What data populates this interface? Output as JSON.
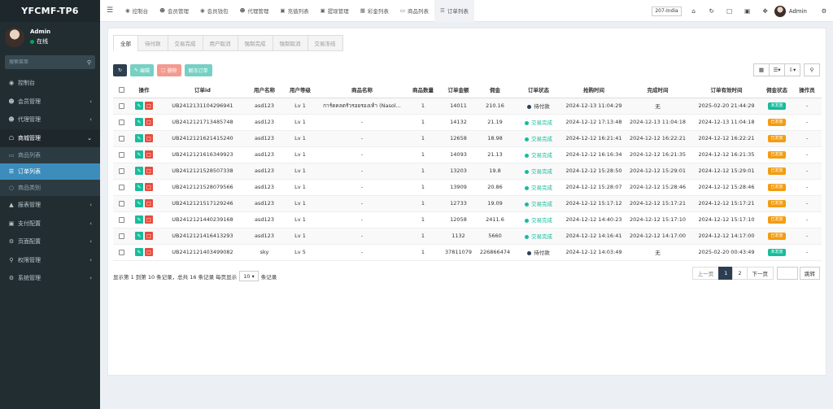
{
  "app": {
    "title": "YFCMF-TP6"
  },
  "sidebar": {
    "user_name": "Admin",
    "user_status": "在线",
    "search_placeholder": "搜索菜单",
    "menu": [
      {
        "label": "控制台",
        "icon": "dashboard-icon"
      },
      {
        "label": "会员管理",
        "icon": "user-icon"
      },
      {
        "label": "代理管理",
        "icon": "users-icon"
      },
      {
        "label": "商城管理",
        "icon": "shop-icon"
      }
    ],
    "submenu": [
      {
        "label": "商品列表",
        "icon": "monitor-icon"
      },
      {
        "label": "订单列表",
        "icon": "list-icon"
      },
      {
        "label": "商品类别",
        "icon": "circle-icon"
      }
    ],
    "menu2": [
      {
        "label": "报表管理",
        "icon": "chart-icon"
      },
      {
        "label": "支付配置",
        "icon": "card-icon"
      },
      {
        "label": "页面配置",
        "icon": "gear-icon"
      },
      {
        "label": "权限管理",
        "icon": "key-icon"
      },
      {
        "label": "系统管理",
        "icon": "cogs-icon"
      }
    ]
  },
  "topbar": {
    "tabs": [
      {
        "label": "控制台"
      },
      {
        "label": "会员管理"
      },
      {
        "label": "会员钱包"
      },
      {
        "label": "代理管理"
      },
      {
        "label": "充值列表"
      },
      {
        "label": "提现管理"
      },
      {
        "label": "彩金列表"
      },
      {
        "label": "商品列表"
      },
      {
        "label": "订单列表"
      }
    ],
    "language": "207-India",
    "admin_name": "Admin"
  },
  "filters": {
    "tabs": [
      "全部",
      "待付款",
      "交易完成",
      "用户取消",
      "强制完成",
      "强制取消",
      "交易冻结"
    ]
  },
  "toolbar": {
    "edit_label": "编辑",
    "delete_label": "删除",
    "unfreeze_label": "解冻订单"
  },
  "table": {
    "headers": [
      "",
      "操作",
      "订单id",
      "用户名称",
      "用户等级",
      "商品名称",
      "商品数量",
      "订单金额",
      "佣金",
      "订单状态",
      "抢购时间",
      "完成时间",
      "订单有效时间",
      "佣金状态",
      "操作员"
    ],
    "rows": [
      {
        "id": "UB2412131104296941",
        "user": "asd123",
        "level": "Lv 1",
        "product": "การ์ดคลตรัวรอยรองเท้า (Nasol...",
        "qty": "1",
        "amount": "14011",
        "commission": "210.16",
        "status": "待付款",
        "status_type": "pending",
        "grab_time": "2024-12-13 11:04:29",
        "finish_time": "无",
        "valid_time": "2025-02-20 21:44:29",
        "comm_status": "未发放",
        "comm_type": "green",
        "operator": "-"
      },
      {
        "id": "UB2412121713485748",
        "user": "asd123",
        "level": "Lv 1",
        "product": "-",
        "qty": "1",
        "amount": "14132",
        "commission": "21.19",
        "status": "交易完成",
        "status_type": "done",
        "grab_time": "2024-12-12 17:13:48",
        "finish_time": "2024-12-13 11:04:18",
        "valid_time": "2024-12-13 11:04:18",
        "comm_status": "已发放",
        "comm_type": "orange",
        "operator": "-"
      },
      {
        "id": "UB2412121621415240",
        "user": "asd123",
        "level": "Lv 1",
        "product": "-",
        "qty": "1",
        "amount": "12658",
        "commission": "18.98",
        "status": "交易完成",
        "status_type": "done",
        "grab_time": "2024-12-12 16:21:41",
        "finish_time": "2024-12-12 16:22:21",
        "valid_time": "2024-12-12 16:22:21",
        "comm_status": "已发放",
        "comm_type": "orange",
        "operator": "-"
      },
      {
        "id": "UB2412121616349923",
        "user": "asd123",
        "level": "Lv 1",
        "product": "-",
        "qty": "1",
        "amount": "14093",
        "commission": "21.13",
        "status": "交易完成",
        "status_type": "done",
        "grab_time": "2024-12-12 16:16:34",
        "finish_time": "2024-12-12 16:21:35",
        "valid_time": "2024-12-12 16:21:35",
        "comm_status": "已发放",
        "comm_type": "orange",
        "operator": "-"
      },
      {
        "id": "UB2412121528507338",
        "user": "asd123",
        "level": "Lv 1",
        "product": "-",
        "qty": "1",
        "amount": "13203",
        "commission": "19.8",
        "status": "交易完成",
        "status_type": "done",
        "grab_time": "2024-12-12 15:28:50",
        "finish_time": "2024-12-12 15:29:01",
        "valid_time": "2024-12-12 15:29:01",
        "comm_status": "已发放",
        "comm_type": "orange",
        "operator": "-"
      },
      {
        "id": "UB2412121528079566",
        "user": "asd123",
        "level": "Lv 1",
        "product": "-",
        "qty": "1",
        "amount": "13909",
        "commission": "20.86",
        "status": "交易完成",
        "status_type": "done",
        "grab_time": "2024-12-12 15:28:07",
        "finish_time": "2024-12-12 15:28:46",
        "valid_time": "2024-12-12 15:28:46",
        "comm_status": "已发放",
        "comm_type": "orange",
        "operator": "-"
      },
      {
        "id": "UB2412121517129246",
        "user": "asd123",
        "level": "Lv 1",
        "product": "-",
        "qty": "1",
        "amount": "12733",
        "commission": "19.09",
        "status": "交易完成",
        "status_type": "done",
        "grab_time": "2024-12-12 15:17:12",
        "finish_time": "2024-12-12 15:17:21",
        "valid_time": "2024-12-12 15:17:21",
        "comm_status": "已发放",
        "comm_type": "orange",
        "operator": "-"
      },
      {
        "id": "UB2412121440239168",
        "user": "asd123",
        "level": "Lv 1",
        "product": "-",
        "qty": "1",
        "amount": "12058",
        "commission": "2411.6",
        "status": "交易完成",
        "status_type": "done",
        "grab_time": "2024-12-12 14:40:23",
        "finish_time": "2024-12-12 15:17:10",
        "valid_time": "2024-12-12 15:17:10",
        "comm_status": "已发放",
        "comm_type": "orange",
        "operator": "-"
      },
      {
        "id": "UB2412121416413293",
        "user": "asd123",
        "level": "Lv 1",
        "product": "-",
        "qty": "1",
        "amount": "1132",
        "commission": "5660",
        "status": "交易完成",
        "status_type": "done",
        "grab_time": "2024-12-12 14:16:41",
        "finish_time": "2024-12-12 14:17:00",
        "valid_time": "2024-12-12 14:17:00",
        "comm_status": "已发放",
        "comm_type": "orange",
        "operator": "-"
      },
      {
        "id": "UB2412121403499082",
        "user": "sky",
        "level": "Lv 5",
        "product": "-",
        "qty": "1",
        "amount": "37811079",
        "commission": "226866474",
        "status": "待付款",
        "status_type": "pending",
        "grab_time": "2024-12-12 14:03:49",
        "finish_time": "无",
        "valid_time": "2025-02-20 00:43:49",
        "comm_status": "未发放",
        "comm_type": "green",
        "operator": "-"
      }
    ]
  },
  "footer": {
    "info_before": "显示第 1 到第 10 条记录，总共 16 条记录 每页显示",
    "page_size": "10",
    "info_after": "条记录"
  },
  "pagination": {
    "prev": "上一页",
    "pages": [
      "1",
      "2"
    ],
    "next": "下一页",
    "jump": "跳转"
  },
  "colors": {
    "sidebar_bg": "#222d32",
    "active_blue": "#3c8dbc",
    "teal": "#18bc9c",
    "red": "#e74c3c",
    "orange": "#f39c12",
    "dark": "#2c3e50"
  }
}
